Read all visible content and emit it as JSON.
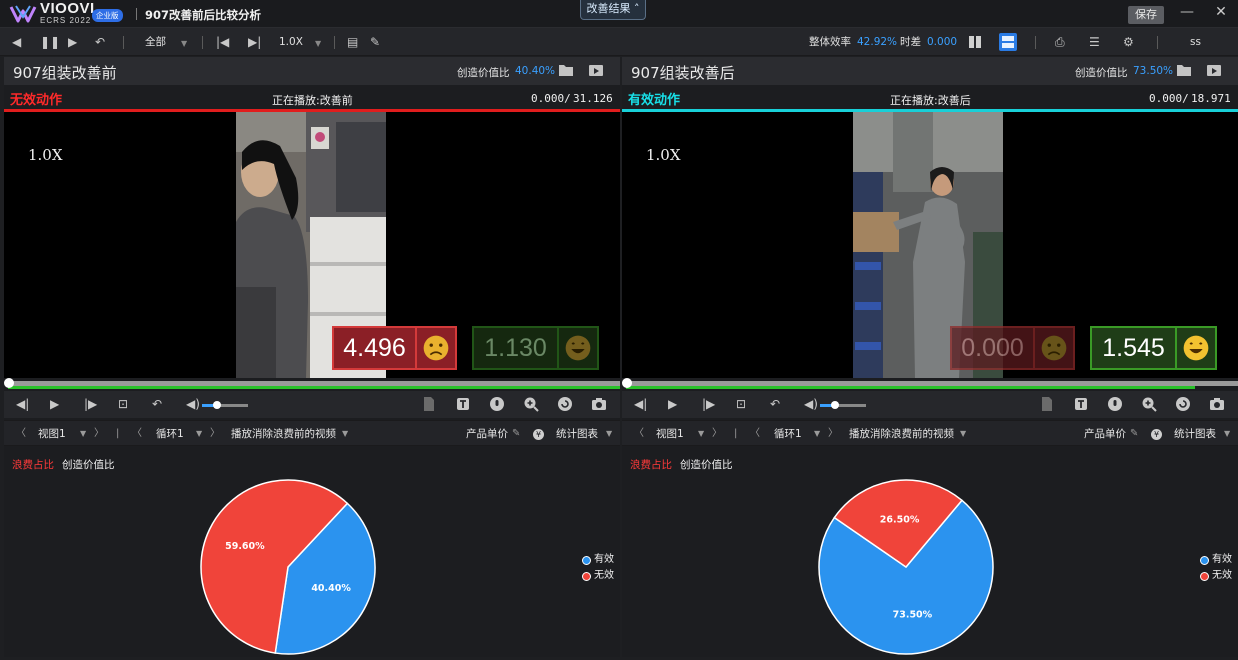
{
  "app": {
    "brand_name": "VIOOVI",
    "brand_sub": "ECRS 2022",
    "edition_badge": "企业版",
    "document_title": "907改善前后比较分析",
    "center_tab": "改善结果",
    "save_label": "保存"
  },
  "toolbar": {
    "scope": "全部",
    "speed": "1.0X",
    "overall_eff_label": "整体效率",
    "overall_eff_value": "42.92%",
    "time_diff_label": "时差",
    "time_diff_value": "0.000",
    "user": "ss"
  },
  "panels": {
    "left": {
      "title": "907组装改善前",
      "ratio_label": "创造价值比",
      "ratio_value": "40.40%",
      "status_label": "无效动作",
      "status_color": "#ff2a2a",
      "now_playing": "正在播放:改善前",
      "time_current": "0.000/",
      "time_total": "31.126",
      "speed": "1.0X",
      "score_bad": "4.496",
      "score_good": "1.130",
      "view": "视图1",
      "cycle": "循环1",
      "play_mode": "播放消除浪费前的视频",
      "unit_price": "产品单价",
      "stats_chart": "统计图表",
      "chart_tab_waste": "浪费占比",
      "chart_tab_value": "创造价值比",
      "progress_fraction": 1.0
    },
    "right": {
      "title": "907组装改善后",
      "ratio_label": "创造价值比",
      "ratio_value": "73.50%",
      "status_label": "有效动作",
      "status_color": "#18e0e8",
      "now_playing": "正在播放:改善后",
      "time_current": "0.000/",
      "time_total": "18.971",
      "speed": "1.0X",
      "score_bad": "0.000",
      "score_good": "1.545",
      "view": "视图1",
      "cycle": "循环1",
      "play_mode": "播放消除浪费前的视频",
      "unit_price": "产品单价",
      "stats_chart": "统计图表",
      "chart_tab_waste": "浪费占比",
      "chart_tab_value": "创造价值比",
      "progress_fraction": 0.93
    }
  },
  "chart_data": [
    {
      "type": "pie",
      "labels": [
        "有效",
        "无效"
      ],
      "values": [
        40.4,
        59.6
      ],
      "value_labels": [
        "40.40%",
        "59.60%"
      ],
      "colors": [
        "#2b93ef",
        "#f0443a"
      ],
      "legend_position": "right"
    },
    {
      "type": "pie",
      "labels": [
        "有效",
        "无效"
      ],
      "values": [
        73.5,
        26.5
      ],
      "value_labels": [
        "73.50%",
        "26.50%"
      ],
      "colors": [
        "#2b93ef",
        "#f0443a"
      ],
      "legend_position": "right"
    }
  ]
}
